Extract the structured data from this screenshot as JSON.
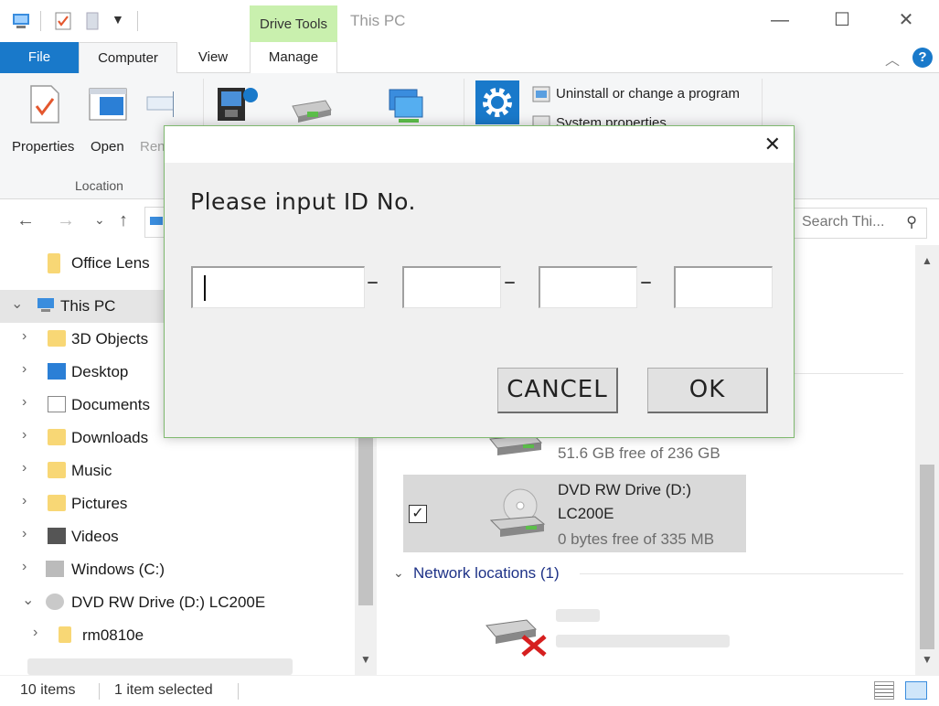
{
  "window": {
    "title": "This PC",
    "contextual_tab_group": "Drive Tools",
    "minimize_glyph": "—",
    "maximize_glyph": "☐",
    "close_glyph": "✕"
  },
  "ribbon_tabs": {
    "file": "File",
    "computer": "Computer",
    "view": "View",
    "manage": "Manage"
  },
  "ribbon": {
    "properties": "Properties",
    "open": "Open",
    "rename_partial": "Ren",
    "location_group": "Location",
    "uninstall": "Uninstall or change a program",
    "system_properties_partial": "System properties"
  },
  "addressbar": {
    "search_placeholder": "Search Thi..."
  },
  "navpane": {
    "items": [
      {
        "label": "Office Lens"
      },
      {
        "label": "This PC"
      },
      {
        "label": "3D Objects"
      },
      {
        "label": "Desktop"
      },
      {
        "label": "Documents"
      },
      {
        "label": "Downloads"
      },
      {
        "label": "Music"
      },
      {
        "label": "Pictures"
      },
      {
        "label": "Videos"
      },
      {
        "label": "Windows (C:)"
      },
      {
        "label": "DVD RW Drive (D:) LC200E"
      },
      {
        "label": "rm0810e"
      }
    ]
  },
  "content": {
    "drive_c_free": "51.6 GB free of 236 GB",
    "drive_d_name": "DVD RW Drive (D:)",
    "drive_d_label": "LC200E",
    "drive_d_free": "0 bytes free of 335 MB",
    "network_section": "Network locations (1)"
  },
  "statusbar": {
    "items_count": "10 items",
    "selected": "1 item selected"
  },
  "dialog": {
    "prompt": "Please input ID No.",
    "dash": "–",
    "cancel": "CANCEL",
    "ok": "OK",
    "close_glyph": "✕",
    "fields": [
      "",
      "",
      "",
      ""
    ]
  },
  "colors": {
    "accent": "#1979ca",
    "contextual": "#c9f0ae",
    "selection": "#cce8ff",
    "section_header": "#1e3287"
  }
}
